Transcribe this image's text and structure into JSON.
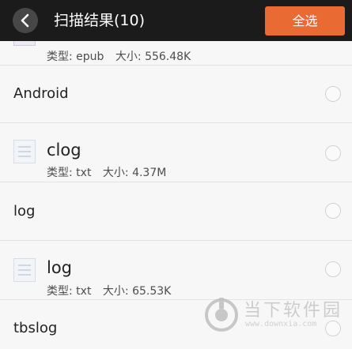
{
  "header": {
    "title": "扫描结果(10)",
    "select_all_label": "全选"
  },
  "labels": {
    "type": "类型:",
    "size": "大小:"
  },
  "files": [
    {
      "name": "",
      "type": "epub",
      "size": "556.48K"
    },
    {
      "name": "Android"
    },
    {
      "name": "clog",
      "type": "txt",
      "size": "4.37M"
    },
    {
      "name": "log"
    },
    {
      "name": "log",
      "type": "txt",
      "size": "65.53K"
    },
    {
      "name": "tbslog"
    }
  ],
  "watermark": {
    "name": "当下软件园",
    "url": "www.downxia.com"
  },
  "colors": {
    "header_bg": "#1b1b1b",
    "accent": "#ea6a34"
  },
  "icons": {
    "back": "chevron-left-icon",
    "file": "document-icon"
  }
}
